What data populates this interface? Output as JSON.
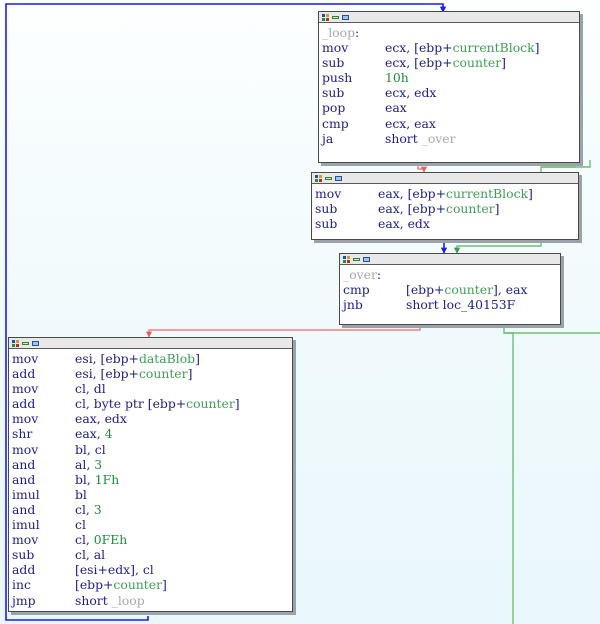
{
  "app": {
    "view": "ida-graph-view",
    "background_top": "#fdffff",
    "background_bottom": "#eaf7fb"
  },
  "colors": {
    "edge_blue": "#1a1aff",
    "edge_red": "#f08080",
    "edge_green": "#6fbf73",
    "mnemonic": "#20208c",
    "constant": "#1e8c3a",
    "variable": "#3f9e57",
    "label": "#a9a9a9",
    "node_bg": "#ffffff",
    "node_border": "#4a4a4a",
    "node_shadow": "#9aa3a8",
    "titlebar": "#e8e8e8"
  },
  "nodes": [
    {
      "id": "node-loop",
      "name": "basic-block-loop",
      "label": "_loop:",
      "lines": [
        {
          "label": "_loop",
          "is_label": true
        },
        {
          "mnemonic": "mov",
          "operands": [
            {
              "t": "op",
              "v": "ecx, [ebp+"
            },
            {
              "t": "var",
              "v": "currentBlock"
            },
            {
              "t": "op",
              "v": "]"
            }
          ]
        },
        {
          "mnemonic": "sub",
          "operands": [
            {
              "t": "op",
              "v": "ecx, [ebp+"
            },
            {
              "t": "var",
              "v": "counter"
            },
            {
              "t": "op",
              "v": "]"
            }
          ]
        },
        {
          "mnemonic": "push",
          "operands": [
            {
              "t": "num",
              "v": "10h"
            }
          ]
        },
        {
          "mnemonic": "sub",
          "operands": [
            {
              "t": "op",
              "v": "ecx, edx"
            }
          ]
        },
        {
          "mnemonic": "pop",
          "operands": [
            {
              "t": "op",
              "v": "eax"
            }
          ]
        },
        {
          "mnemonic": "cmp",
          "operands": [
            {
              "t": "op",
              "v": "ecx, eax"
            }
          ]
        },
        {
          "mnemonic": "ja",
          "operands": [
            {
              "t": "op",
              "v": "short "
            },
            {
              "t": "tgt",
              "v": "_over"
            }
          ]
        }
      ]
    },
    {
      "id": "node-sub",
      "name": "basic-block-subtract",
      "label": "",
      "lines": [
        {
          "mnemonic": "mov",
          "operands": [
            {
              "t": "op",
              "v": "eax, [ebp+"
            },
            {
              "t": "var",
              "v": "currentBlock"
            },
            {
              "t": "op",
              "v": "]"
            }
          ]
        },
        {
          "mnemonic": "sub",
          "operands": [
            {
              "t": "op",
              "v": "eax, [ebp+"
            },
            {
              "t": "var",
              "v": "counter"
            },
            {
              "t": "op",
              "v": "]"
            }
          ]
        },
        {
          "mnemonic": "sub",
          "operands": [
            {
              "t": "op",
              "v": "eax, edx"
            }
          ]
        }
      ]
    },
    {
      "id": "node-over",
      "name": "basic-block-over",
      "label": "_over:",
      "lines": [
        {
          "label": "_over",
          "is_label": true
        },
        {
          "mnemonic": "cmp",
          "operands": [
            {
              "t": "op",
              "v": "[ebp+"
            },
            {
              "t": "var",
              "v": "counter"
            },
            {
              "t": "op",
              "v": "], eax"
            }
          ]
        },
        {
          "mnemonic": "jnb",
          "operands": [
            {
              "t": "op",
              "v": "short "
            },
            {
              "t": "loc",
              "v": "loc_40153F"
            }
          ]
        }
      ]
    },
    {
      "id": "node-body",
      "name": "basic-block-decrypt-body",
      "label": "",
      "lines": [
        {
          "mnemonic": "mov",
          "operands": [
            {
              "t": "op",
              "v": "esi, [ebp+"
            },
            {
              "t": "var",
              "v": "dataBlob"
            },
            {
              "t": "op",
              "v": "]"
            }
          ]
        },
        {
          "mnemonic": "add",
          "operands": [
            {
              "t": "op",
              "v": "esi, [ebp+"
            },
            {
              "t": "var",
              "v": "counter"
            },
            {
              "t": "op",
              "v": "]"
            }
          ]
        },
        {
          "mnemonic": "mov",
          "operands": [
            {
              "t": "op",
              "v": "cl, dl"
            }
          ]
        },
        {
          "mnemonic": "add",
          "operands": [
            {
              "t": "op",
              "v": "cl, byte ptr [ebp+"
            },
            {
              "t": "var",
              "v": "counter"
            },
            {
              "t": "op",
              "v": "]"
            }
          ]
        },
        {
          "mnemonic": "mov",
          "operands": [
            {
              "t": "op",
              "v": "eax, edx"
            }
          ]
        },
        {
          "mnemonic": "shr",
          "operands": [
            {
              "t": "op",
              "v": "eax, "
            },
            {
              "t": "num",
              "v": "4"
            }
          ]
        },
        {
          "mnemonic": "mov",
          "operands": [
            {
              "t": "op",
              "v": "bl, cl"
            }
          ]
        },
        {
          "mnemonic": "and",
          "operands": [
            {
              "t": "op",
              "v": "al, "
            },
            {
              "t": "num",
              "v": "3"
            }
          ]
        },
        {
          "mnemonic": "and",
          "operands": [
            {
              "t": "op",
              "v": "bl, "
            },
            {
              "t": "num",
              "v": "1Fh"
            }
          ]
        },
        {
          "mnemonic": "imul",
          "operands": [
            {
              "t": "op",
              "v": "bl"
            }
          ]
        },
        {
          "mnemonic": "and",
          "operands": [
            {
              "t": "op",
              "v": "cl, "
            },
            {
              "t": "num",
              "v": "3"
            }
          ]
        },
        {
          "mnemonic": "imul",
          "operands": [
            {
              "t": "op",
              "v": "cl"
            }
          ]
        },
        {
          "mnemonic": "mov",
          "operands": [
            {
              "t": "op",
              "v": "cl, "
            },
            {
              "t": "num",
              "v": "0FEh"
            }
          ]
        },
        {
          "mnemonic": "sub",
          "operands": [
            {
              "t": "op",
              "v": "cl, al"
            }
          ]
        },
        {
          "mnemonic": "add",
          "operands": [
            {
              "t": "op",
              "v": "[esi+edx], cl"
            }
          ]
        },
        {
          "mnemonic": "inc",
          "operands": [
            {
              "t": "op",
              "v": "[ebp+"
            },
            {
              "t": "var",
              "v": "counter"
            },
            {
              "t": "op",
              "v": "]"
            }
          ]
        },
        {
          "mnemonic": "jmp",
          "operands": [
            {
              "t": "op",
              "v": "short "
            },
            {
              "t": "tgt",
              "v": "_loop"
            }
          ]
        }
      ]
    }
  ],
  "edges": [
    {
      "name": "edge-body-to-loop",
      "color": "#1a1aff",
      "kind": "backedge"
    },
    {
      "name": "edge-loop-to-sub",
      "color": "#f08080",
      "kind": "conditional-taken"
    },
    {
      "name": "edge-loop-to-over",
      "color": "#6fbf73",
      "kind": "conditional-fallthrough"
    },
    {
      "name": "edge-sub-to-over",
      "color": "#1a1aff",
      "kind": "flow"
    },
    {
      "name": "edge-over-to-body",
      "color": "#f08080",
      "kind": "conditional-taken"
    },
    {
      "name": "edge-over-exit",
      "color": "#6fbf73",
      "kind": "conditional-exit"
    }
  ]
}
